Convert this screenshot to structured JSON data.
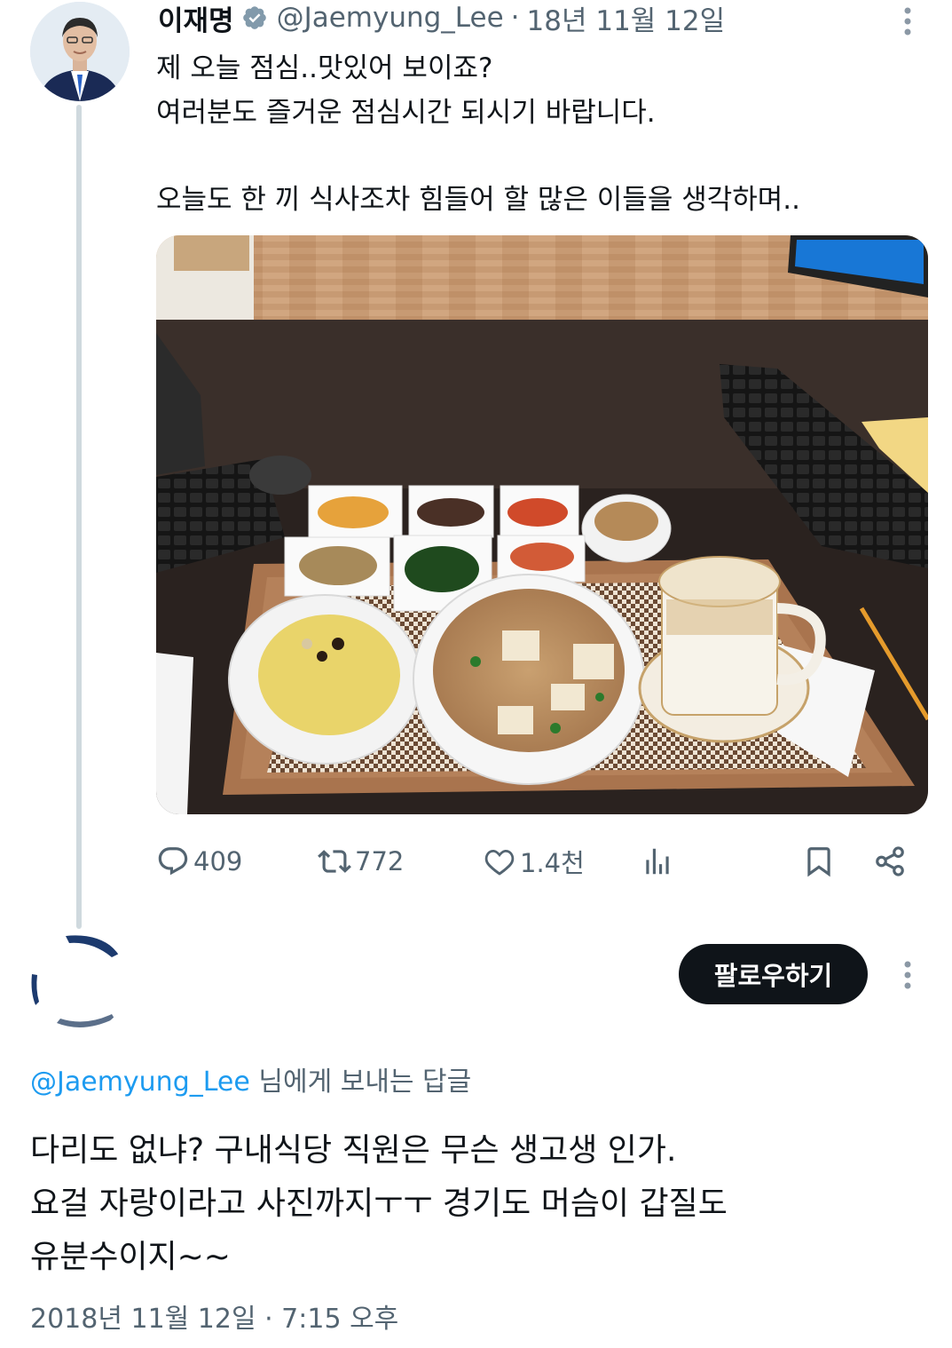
{
  "tweet": {
    "author_name": "이재명",
    "verified_icon": "verified-badge-icon",
    "handle": "@Jaemyung_Lee",
    "separator": "·",
    "date": "18년 11월 12일",
    "text_lines": [
      "제 오늘 점심..맛있어 보이죠?",
      "여러분도 즐거운 점심시간 되시기 바랍니다.",
      "오늘도 한 끼 식사조차 힘들어 할 많은 이들을 생각하며.."
    ],
    "photo": {
      "subject": "lunch-tray-photo"
    },
    "actions": {
      "reply_count": "409",
      "retweet_count": "772",
      "like_count": "1.4천"
    }
  },
  "reply": {
    "follow_label": "팔로우하기",
    "reply_to_mention": "@Jaemyung_Lee",
    "reply_to_suffix": " 님에게 보내는 답글",
    "text_lines": [
      "다리도 없냐? 구내식당 직원은 무슨 생고생 인가.",
      "요걸 자랑이라고 사진까지ㅜㅜ 경기도 머슴이 갑질도",
      "유분수이지~~"
    ],
    "timestamp": "2018년 11월 12일 · 7:15 오후"
  },
  "colors": {
    "text_primary": "#0f1419",
    "text_secondary": "#536471",
    "accent": "#1d9bf0",
    "thread_line": "#cfd9de",
    "button_dark": "#0f1419"
  }
}
